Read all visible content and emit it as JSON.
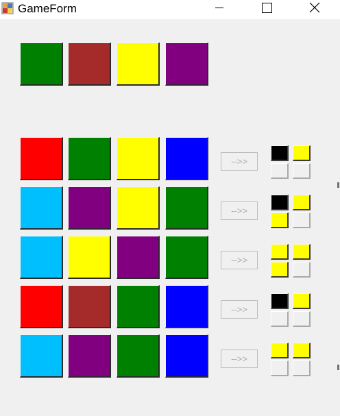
{
  "window": {
    "title": "GameForm",
    "controls": [
      "minimize-icon",
      "maximize-icon",
      "close-icon"
    ]
  },
  "colors": {
    "green": "#008000",
    "brown": "#a52a2a",
    "yellow": "#ffff00",
    "purple": "#800080",
    "red": "#ff0000",
    "blue": "#0000ff",
    "cyan": "#00bfff",
    "black": "#000000",
    "empty": "#f0f0f0"
  },
  "secret": [
    "green",
    "brown",
    "yellow",
    "purple"
  ],
  "guesses": [
    {
      "colors": [
        "red",
        "green",
        "yellow",
        "blue"
      ],
      "button": "-->>",
      "feedback": [
        "black",
        "yellow",
        "empty",
        "empty"
      ]
    },
    {
      "colors": [
        "cyan",
        "purple",
        "yellow",
        "green"
      ],
      "button": "-->>",
      "feedback": [
        "black",
        "yellow",
        "yellow",
        "empty"
      ]
    },
    {
      "colors": [
        "cyan",
        "yellow",
        "purple",
        "green"
      ],
      "button": "-->>",
      "feedback": [
        "yellow",
        "yellow",
        "yellow",
        "empty"
      ]
    },
    {
      "colors": [
        "red",
        "brown",
        "green",
        "blue"
      ],
      "button": "-->>",
      "feedback": [
        "black",
        "yellow",
        "empty",
        "empty"
      ]
    },
    {
      "colors": [
        "cyan",
        "purple",
        "green",
        "blue"
      ],
      "button": "-->>",
      "feedback": [
        "yellow",
        "yellow",
        "empty",
        "empty"
      ]
    }
  ]
}
